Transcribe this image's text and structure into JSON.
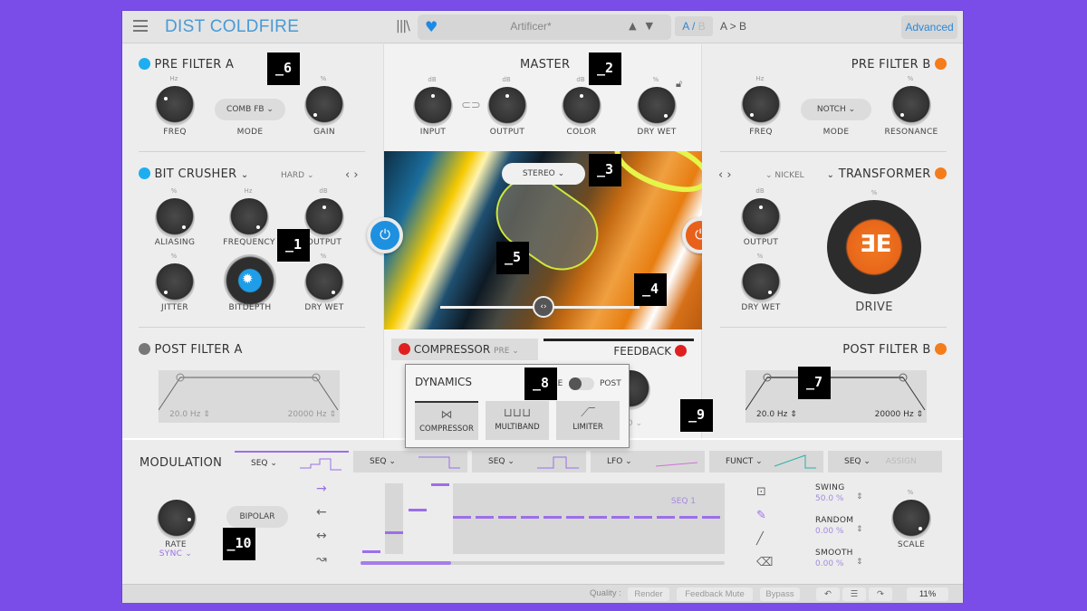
{
  "app": {
    "title": "DIST COLDFIRE",
    "preset_name": "Artificer*",
    "ab_a": "A",
    "ab_sep": "/",
    "ab_b": "B",
    "a_to_b": "A > B",
    "advanced": "Advanced",
    "library_icon": "|||\\"
  },
  "pre_filter_a": {
    "title": "PRE FILTER A",
    "freq_label": "FREQ",
    "freq_unit": "Hz",
    "mode_label": "MODE",
    "mode_value": "COMB FB",
    "gain_label": "GAIN",
    "gain_unit": "%",
    "enabled_color": "#1daef0"
  },
  "master": {
    "title": "MASTER",
    "knobs": [
      {
        "label": "INPUT",
        "unit": "dB"
      },
      {
        "label": "OUTPUT",
        "unit": "dB"
      },
      {
        "label": "COLOR",
        "unit": "dB"
      },
      {
        "label": "DRY WET",
        "unit": "%"
      }
    ]
  },
  "pre_filter_b": {
    "title": "PRE FILTER B",
    "freq_label": "FREQ",
    "freq_unit": "Hz",
    "mode_label": "MODE",
    "mode_value": "NOTCH",
    "res_label": "RESONANCE",
    "res_unit": "%",
    "enabled_color": "#f57c1a"
  },
  "bit_crusher": {
    "title": "BIT CRUSHER",
    "type": "HARD",
    "knobs": [
      {
        "label": "ALIASING",
        "unit": "%"
      },
      {
        "label": "FREQUENCY",
        "unit": "Hz"
      },
      {
        "label": "OUTPUT",
        "unit": "dB"
      },
      {
        "label": "JITTER",
        "unit": "%"
      },
      {
        "label": "BITDEPTH",
        "unit": ""
      },
      {
        "label": "DRY WET",
        "unit": "%"
      }
    ]
  },
  "transformer": {
    "title": "TRANSFORMER",
    "type": "NICKEL",
    "output_label": "OUTPUT",
    "output_unit": "dB",
    "drywet_label": "DRY WET",
    "drywet_unit": "%",
    "drive_label": "DRIVE",
    "drive_unit": "%"
  },
  "center": {
    "stereo_mode": "STEREO",
    "compressor": "COMPRESSOR",
    "compressor_pos": "PRE",
    "feedback": "FEEDBACK"
  },
  "post_filter_a": {
    "title": "POST FILTER A",
    "low": "20.0 Hz",
    "high": "20000 Hz"
  },
  "post_filter_b": {
    "title": "POST FILTER B",
    "low": "20.0 Hz",
    "high": "20000 Hz"
  },
  "dynamics_popup": {
    "title": "DYNAMICS",
    "pre": "PRE",
    "post": "POST",
    "options": [
      "COMPRESSOR",
      "MULTIBAND",
      "LIMITER"
    ],
    "selected": "COMPRESSOR",
    "hidden_text": "ED"
  },
  "modulation": {
    "title": "MODULATION",
    "tabs": [
      {
        "label": "SEQ"
      },
      {
        "label": "SEQ"
      },
      {
        "label": "SEQ"
      },
      {
        "label": "LFO"
      },
      {
        "label": "FUNCT"
      },
      {
        "label": "SEQ",
        "assign": "ASSIGN"
      }
    ],
    "rate_label": "RATE",
    "rate_mode": "SYNC",
    "bipolar": "BIPOLAR",
    "seq_name": "SEQ 1",
    "swing_label": "SWING",
    "swing_value": "50.0 %",
    "random_label": "RANDOM",
    "random_value": "0.00 %",
    "smooth_label": "SMOOTH",
    "smooth_value": "0.00 %",
    "scale_label": "SCALE",
    "scale_unit": "%"
  },
  "statusbar": {
    "quality": "Quality :",
    "render": "Render",
    "feedback_mute": "Feedback Mute",
    "bypass": "Bypass",
    "zoom": "11%"
  },
  "markers": [
    "_1",
    "_2",
    "_3",
    "_4",
    "_5",
    "_6",
    "_7",
    "_8",
    "_9",
    "_10"
  ]
}
